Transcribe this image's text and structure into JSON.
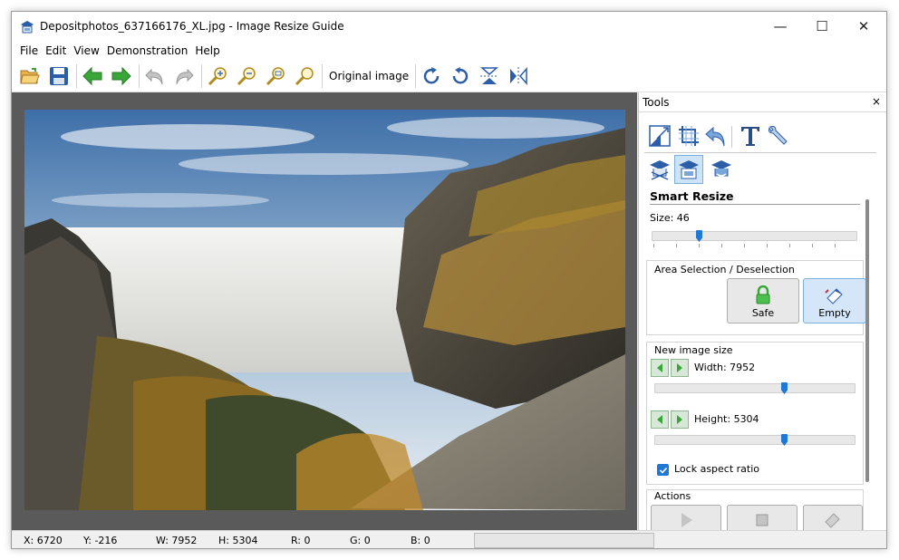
{
  "window": {
    "title": "Depositphotos_637166176_XL.jpg - Image Resize Guide",
    "controls": {
      "minimize": "—",
      "maximize": "☐",
      "close": "✕"
    }
  },
  "menu": [
    "File",
    "Edit",
    "View",
    "Demonstration",
    "Help"
  ],
  "toolbar": {
    "original_image_label": "Original image",
    "icons": [
      "open-folder-icon",
      "save-icon",
      "back-arrow-icon",
      "forward-arrow-icon",
      "undo-icon",
      "redo-icon",
      "zoom-in-icon",
      "zoom-out-icon",
      "zoom-fit-icon",
      "zoom-actual-icon",
      "rotate-right-icon",
      "rotate-left-icon",
      "flip-vertical-icon",
      "flip-horizontal-icon"
    ]
  },
  "tools_panel": {
    "header": "Tools",
    "close": "×",
    "section_title": "Smart Resize",
    "size_label": "Size: 46",
    "size_value": 46,
    "area_group": {
      "title": "Area Selection / Deselection",
      "safe_label": "Safe",
      "empty_label": "Empty"
    },
    "new_size_group": {
      "title": "New image size",
      "width_label": "Width: 7952",
      "height_label": "Height: 5304",
      "width_slider_fraction": 0.65,
      "height_slider_fraction": 0.65
    },
    "lock_aspect_label": "Lock aspect ratio",
    "lock_aspect_checked": true,
    "actions_label": "Actions"
  },
  "status": {
    "x": "X: 6720",
    "y": "Y: -216",
    "w": "W: 7952",
    "h": "H: 5304",
    "r": "R: 0",
    "g": "G: 0",
    "b": "B: 0"
  },
  "colors": {
    "accent": "#1e78d4",
    "canvas_bg": "#5a5a5a",
    "arrow_green": "#3aa63a"
  }
}
